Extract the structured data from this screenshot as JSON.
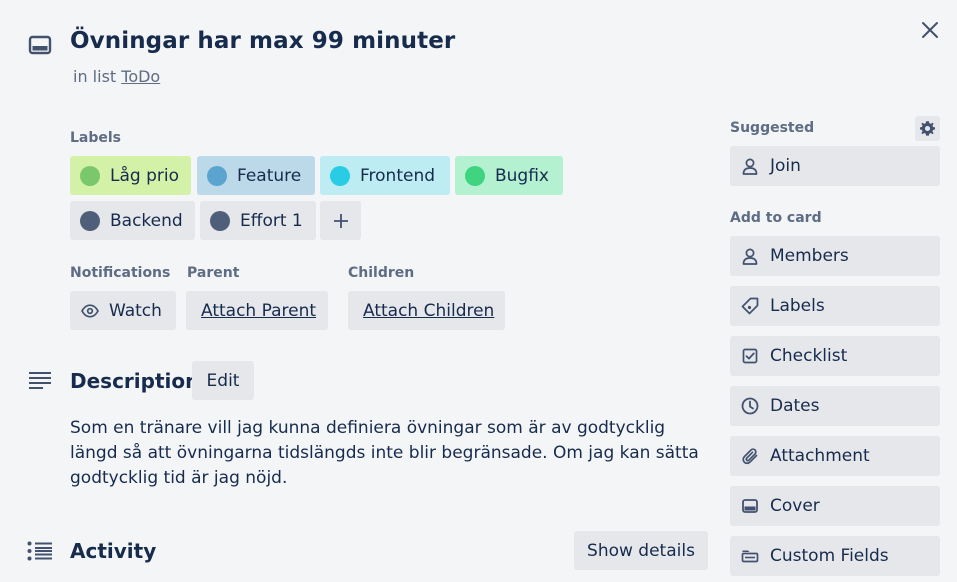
{
  "card": {
    "title": "Övningar har max 99 minuter",
    "in_list_prefix": "in list",
    "list_name": "ToDo"
  },
  "labels": {
    "heading": "Labels",
    "items": [
      {
        "name": "Låg prio",
        "bg": "#d3f1a7",
        "dot": "#7bc86c"
      },
      {
        "name": "Feature",
        "bg": "#bcd9ea",
        "dot": "#5ba4cf"
      },
      {
        "name": "Frontend",
        "bg": "#bdecf3",
        "dot": "#29cce5"
      },
      {
        "name": "Bugfix",
        "bg": "#b3f1d0",
        "dot": "#3fd47f"
      },
      {
        "name": "Backend",
        "bg": "#e5e7eb",
        "dot": "#505f79"
      },
      {
        "name": "Effort 1",
        "bg": "#e5e7eb",
        "dot": "#505f79"
      }
    ],
    "add_icon": "plus-icon"
  },
  "notifications": {
    "heading": "Notifications",
    "watch_label": "Watch"
  },
  "parent": {
    "heading": "Parent",
    "attach_label": "Attach Parent"
  },
  "children": {
    "heading": "Children",
    "attach_label": "Attach Children"
  },
  "description": {
    "heading": "Description",
    "edit_label": "Edit",
    "text": "Som en tränare vill jag kunna definiera övningar som är av godtycklig längd så att övningarna tidslängds inte blir begränsade. Om jag kan sätta godtycklig tid är jag nöjd."
  },
  "activity": {
    "heading": "Activity",
    "show_details_label": "Show details"
  },
  "sidebar": {
    "suggested_heading": "Suggested",
    "join_label": "Join",
    "add_to_card_heading": "Add to card",
    "members_label": "Members",
    "labels_label": "Labels",
    "checklist_label": "Checklist",
    "dates_label": "Dates",
    "attachment_label": "Attachment",
    "cover_label": "Cover",
    "custom_fields_label": "Custom Fields"
  }
}
